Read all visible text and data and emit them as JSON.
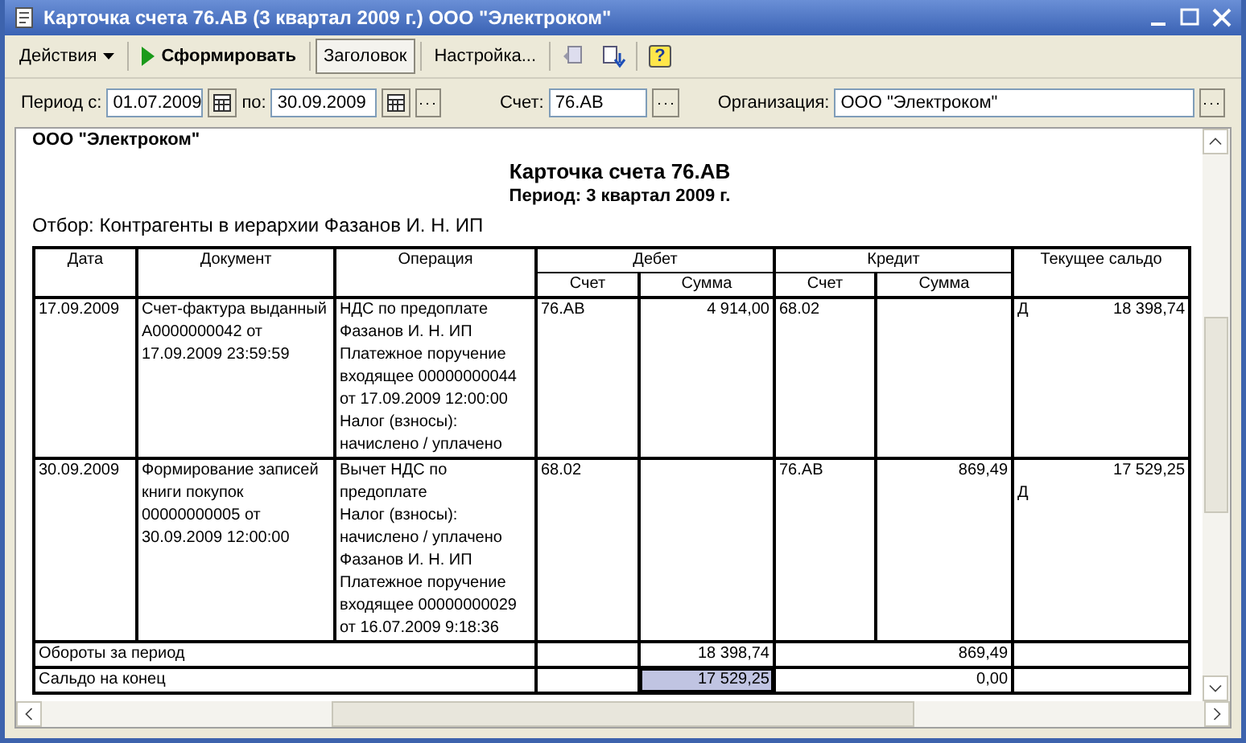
{
  "window": {
    "title": "Карточка счета 76.АВ (3 квартал 2009 г.) ООО \"Электроком\""
  },
  "toolbar": {
    "actions_menu": "Действия",
    "run_button": "Сформировать",
    "header_toggle": {
      "label": "Заголовок",
      "selected": true
    },
    "settings_button": "Настройка...",
    "help_button": "?"
  },
  "filters": {
    "period_from_label": "Период с:",
    "period_from": "01.07.2009",
    "period_to_label": "по:",
    "period_to": "30.09.2009",
    "account_label": "Счет:",
    "account": "76.АВ",
    "org_label": "Организация:",
    "org": "ООО \"Электроком\""
  },
  "report": {
    "org": "ООО \"Электроком\"",
    "title": "Карточка счета 76.АВ",
    "period": "Период: 3 квартал 2009 г.",
    "selection": "Отбор: Контрагенты в иерархии Фазанов И. Н. ИП",
    "columns": {
      "date": "Дата",
      "document": "Документ",
      "operation": "Операция",
      "debit": "Дебет",
      "credit": "Кредит",
      "balance": "Текущее сальдо",
      "account": "Счет",
      "sum": "Сумма",
      "credit_account": "Счет",
      "credit_sum": "Сумма"
    },
    "rows": [
      {
        "date": "17.09.2009",
        "document": "Счет-фактура выданный А0000000042 от 17.09.2009 23:59:59",
        "operation": [
          "НДС по предоплате",
          "Фазанов  И. Н. ИП",
          "Платежное поручение входящее 00000000044 от 17.09.2009 12:00:00",
          "Налог (взносы): начислено / уплачено"
        ],
        "debit_account": "76.АВ",
        "debit_sum": "4 914,00",
        "credit_account": "68.02",
        "credit_sum": "",
        "balance_side": "Д",
        "balance": "18 398,74",
        "kind": "inline"
      },
      {
        "date": "30.09.2009",
        "document": "Формирование записей книги покупок 00000000005 от 30.09.2009 12:00:00",
        "operation": [
          "Вычет НДС по предоплате",
          "Налог (взносы): начислено / уплачено",
          "Фазанов  И. Н. ИП",
          "Платежное поручение входящее 00000000029 от 16.07.2009 9:18:36"
        ],
        "debit_account": "68.02",
        "debit_sum": "",
        "credit_account": "76.АВ",
        "credit_sum": "869,49",
        "balance_side": "Д",
        "balance": "17 529,25",
        "kind": "stacked"
      }
    ],
    "totals": [
      {
        "label": "Обороты за период",
        "debit_sum": {
          "text": "18 398,74",
          "selected": false
        },
        "credit_sum": {
          "text": "869,49",
          "selected": false
        }
      },
      {
        "label": "Сальдо на конец",
        "debit_sum": {
          "text": "17 529,25",
          "selected": true
        },
        "credit_sum": {
          "text": "0,00",
          "selected": false
        }
      }
    ]
  }
}
